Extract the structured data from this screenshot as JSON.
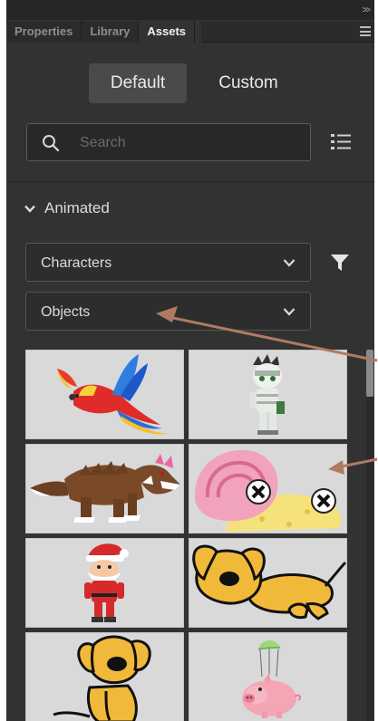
{
  "tabs": [
    {
      "label": "Properties",
      "active": false
    },
    {
      "label": "Library",
      "active": false
    },
    {
      "label": "Assets",
      "active": true
    }
  ],
  "toggle": {
    "default_label": "Default",
    "custom_label": "Custom",
    "selected": "Default"
  },
  "search": {
    "placeholder": "Search",
    "value": ""
  },
  "section": {
    "label": "Animated",
    "expanded": true
  },
  "dropdowns": {
    "characters": {
      "selected": "Characters"
    },
    "objects": {
      "selected": "Objects"
    }
  },
  "assets": [
    {
      "name": "parrot",
      "row": 1
    },
    {
      "name": "mummy",
      "row": 1
    },
    {
      "name": "wolf",
      "row": 2
    },
    {
      "name": "snail",
      "row": 2
    },
    {
      "name": "santa",
      "row": 3
    },
    {
      "name": "dog-lying",
      "row": 3
    },
    {
      "name": "dog-sitting",
      "row": 4
    },
    {
      "name": "pig-parachute",
      "row": 4
    }
  ],
  "colors": {
    "panel_bg": "#323232",
    "tab_bar_bg": "#2b2b2b",
    "thumbnail_bg": "#d9d9d9",
    "annotation_arrow": "#b07a62"
  }
}
